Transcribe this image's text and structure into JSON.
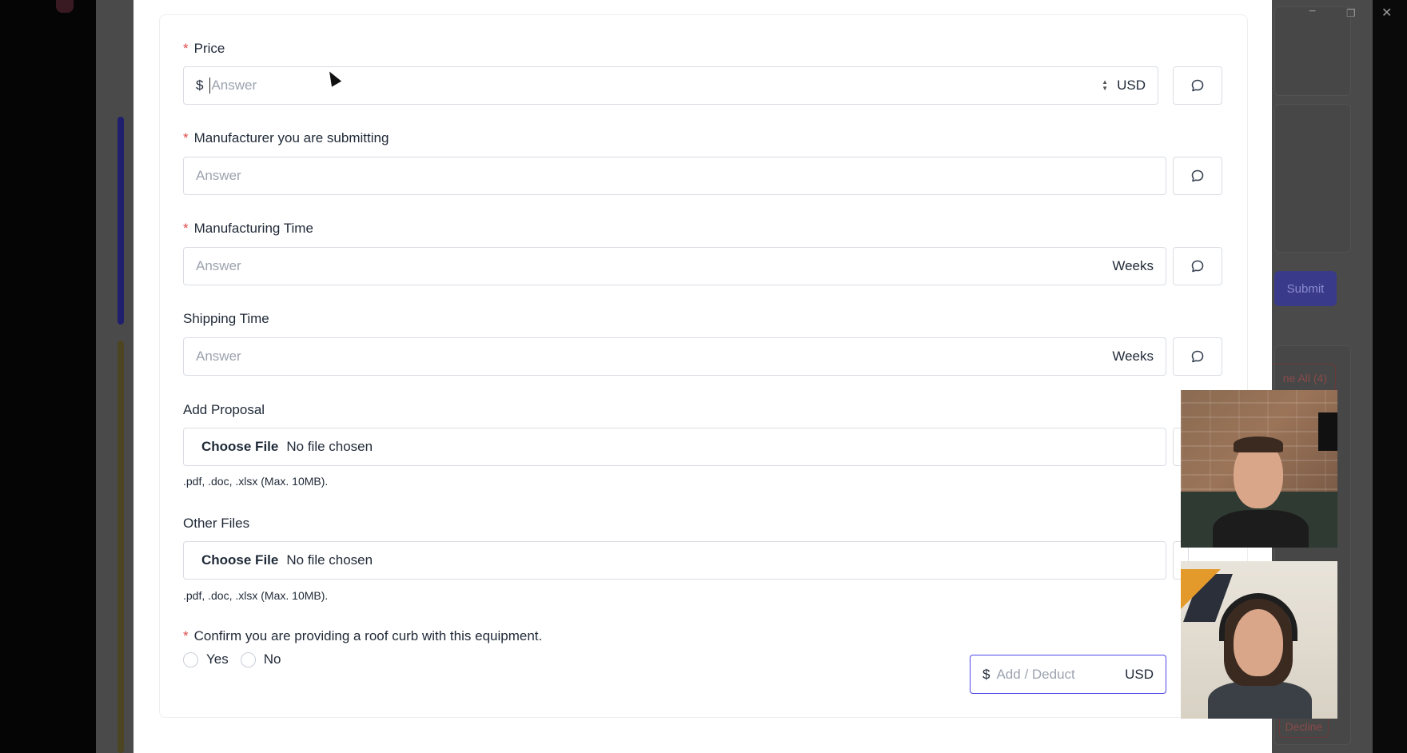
{
  "window_controls": {
    "minimize": "−",
    "restore": "❐",
    "close": "✕"
  },
  "background": {
    "submit_label": "Submit",
    "decline_all_label": "ne All (4)",
    "decline_label": "Decline"
  },
  "form": {
    "price": {
      "label": "Price",
      "required_mark": "*",
      "prefix": "$",
      "placeholder": "Answer",
      "unit": "USD"
    },
    "manufacturer": {
      "label": "Manufacturer you are submitting",
      "required_mark": "*",
      "placeholder": "Answer"
    },
    "manufacturing_time": {
      "label": "Manufacturing Time",
      "required_mark": "*",
      "placeholder": "Answer",
      "unit": "Weeks"
    },
    "shipping_time": {
      "label": "Shipping Time",
      "placeholder": "Answer",
      "unit": "Weeks"
    },
    "add_proposal": {
      "label": "Add Proposal",
      "choose_label": "Choose File",
      "status": "No file chosen",
      "hint": ".pdf, .doc, .xlsx (Max. 10MB)."
    },
    "other_files": {
      "label": "Other Files",
      "choose_label": "Choose File",
      "status": "No file chosen",
      "hint": ".pdf, .doc, .xlsx (Max. 10MB)."
    },
    "roof_curb": {
      "label": "Confirm you are providing a roof curb with this equipment.",
      "required_mark": "*",
      "options": [
        "Yes",
        "No"
      ],
      "add_deduct": {
        "prefix": "$",
        "placeholder": "Add / Deduct",
        "unit": "USD"
      }
    }
  },
  "icons": {
    "comment": "comment-icon",
    "spinner": "spinner-arrows-icon",
    "cursor": "mouse-cursor-icon"
  },
  "colors": {
    "required": "#e04848",
    "focus_border": "#4f46e5",
    "placeholder": "#9ca3af"
  }
}
